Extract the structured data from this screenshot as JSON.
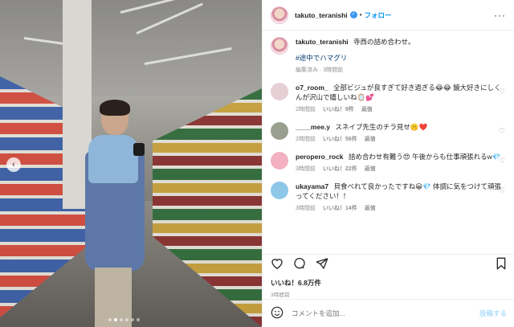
{
  "media": {
    "carousel": {
      "dots": 6,
      "active_index": 1
    },
    "nav_left_icon": "chevron-left-icon"
  },
  "header": {
    "username": "takuto_teranishi",
    "verified_icon": "verified-badge-icon",
    "separator": "•",
    "follow_label": "フォロー",
    "more_icon": "more-horizontal-icon"
  },
  "caption": {
    "username": "takuto_teranishi",
    "text": "寺西の詰め合わせ。",
    "hashtag": "#途中でハマグリ",
    "meta": "編集済み · 3時間前"
  },
  "comments": [
    {
      "username": "o7_room_",
      "text": "全部ビジュが良すぎて好き過ぎる😂😂 鏡大好きにしくんが沢山で嬉しいね🪞💕",
      "time": "2時間前",
      "likes": "いいね！9件",
      "reply": "返信",
      "avatar_color": "#e7cfd6"
    },
    {
      "username": "____mee.y",
      "text": "スネイプ先生のチラ見せ🤫❤️",
      "time": "2時間前",
      "likes": "いいね！56件",
      "reply": "返信",
      "avatar_color": "#9aa08f"
    },
    {
      "username": "peropero_rock",
      "text": "詰め合わせ有難う😍 午後からも仕事頑張れるw💎",
      "time": "3時間前",
      "likes": "いいね！22件",
      "reply": "返信",
      "avatar_color": "#f2b0c0"
    },
    {
      "username": "ukayama7",
      "text": "貝食べれて良かったですね😀💎 体調に気をつけて頑張ってください！！",
      "time": "3時間前",
      "likes": "いいね！14件",
      "reply": "返信",
      "avatar_color": "#8ec7e8"
    }
  ],
  "actions": {
    "like_icon": "heart-icon",
    "comment_icon": "comment-icon",
    "share_icon": "paper-plane-icon",
    "bookmark_icon": "bookmark-icon",
    "likes_count": "いいね！6.8万件",
    "posted_time": "3時間前"
  },
  "add_comment": {
    "emoji_icon": "smiley-icon",
    "placeholder": "コメントを追加...",
    "post_label": "投稿する"
  },
  "colors": {
    "accent": "#0095f6",
    "text": "#262626",
    "muted": "#8e8e8e",
    "post_disabled": "#b2dffc"
  }
}
